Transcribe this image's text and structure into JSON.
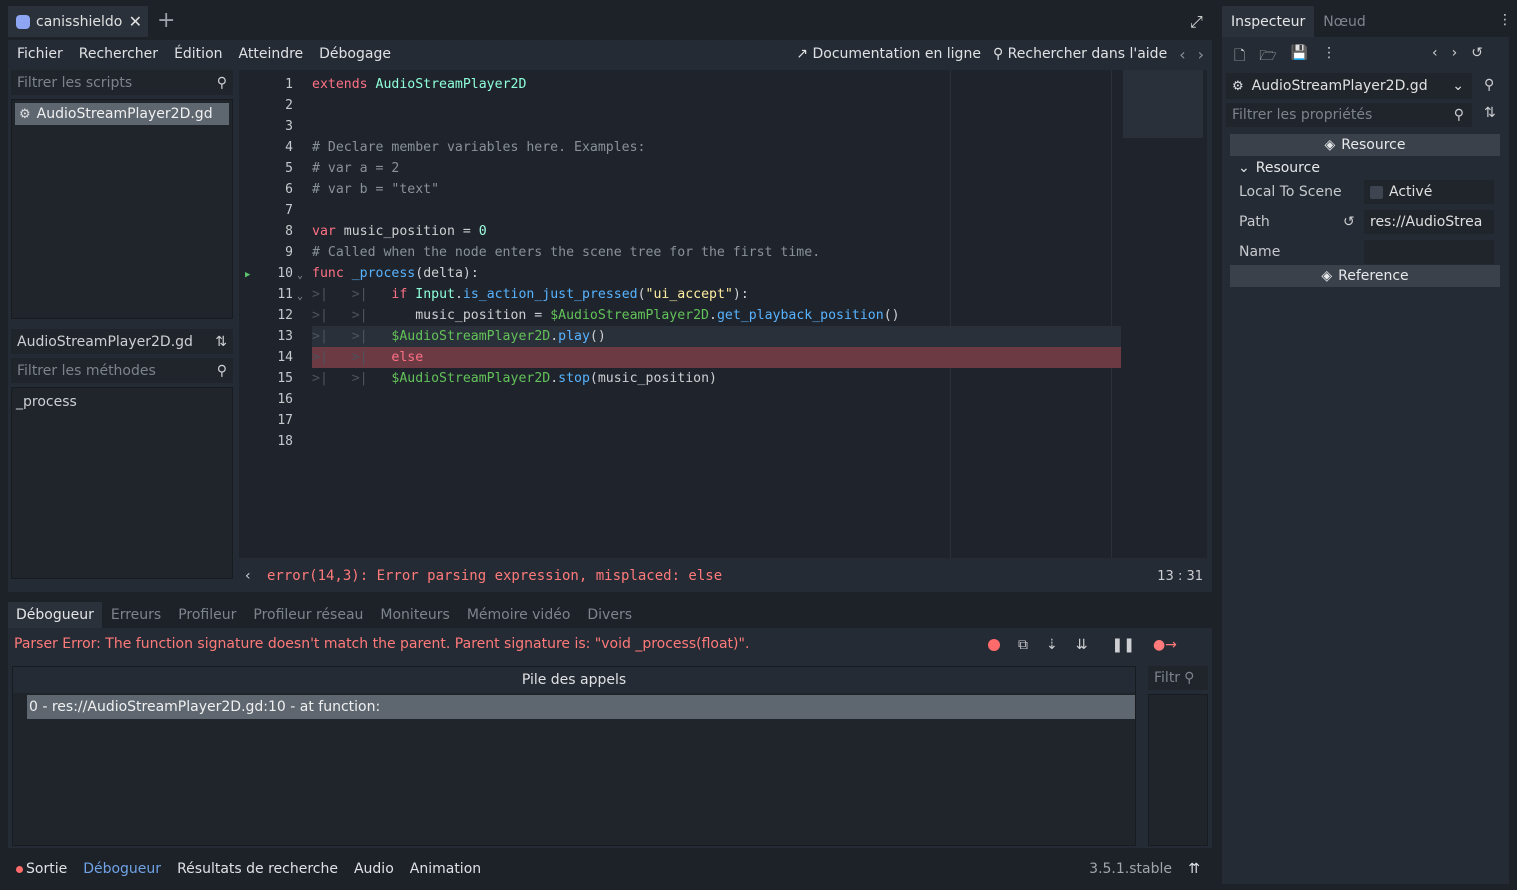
{
  "scene_tab": {
    "label": "canisshieldo"
  },
  "menus": [
    "Fichier",
    "Rechercher",
    "Édition",
    "Atteindre",
    "Débogage"
  ],
  "menu_right": {
    "docs": "Documentation en ligne",
    "help": "Rechercher dans l'aide"
  },
  "scripts": {
    "filter_placeholder": "Filtrer les scripts",
    "items": [
      "AudioStreamPlayer2D.gd"
    ]
  },
  "methods": {
    "current_script": "AudioStreamPlayer2D.gd",
    "filter_placeholder": "Filtrer les méthodes",
    "items": [
      "_process"
    ]
  },
  "editor": {
    "line_numbers": [
      "1",
      "2",
      "3",
      "4",
      "5",
      "6",
      "7",
      "8",
      "9",
      "10",
      "11",
      "12",
      "13",
      "14",
      "15",
      "16",
      "17",
      "18"
    ],
    "lines": {
      "l1_kw": "extends",
      "l1_type": "AudioStreamPlayer2D",
      "l4": "# Declare member variables here. Examples:",
      "l5": "# var a = 2",
      "l6": "# var b = \"text\"",
      "l8_kw": "var",
      "l8_name": "music_position = ",
      "l8_num": "0",
      "l9": "# Called when the node enters the scene tree for the first time.",
      "l10_kw": "func",
      "l10_fn": "_process",
      "l10_rest": "(delta):",
      "l11_kw": "if",
      "l11_type": "Input",
      "l11_dot": ".",
      "l11_fn": "is_action_just_pressed",
      "l11_open": "(",
      "l11_str": "\"ui_accept\"",
      "l11_close": "):",
      "l12_name": "music_position = ",
      "l12_node": "$AudioStreamPlayer2D",
      "l12_dot": ".",
      "l12_fn": "get_playback_position",
      "l12_close": "()",
      "l13_node": "$AudioStreamPlayer2D",
      "l13_dot": ".",
      "l13_fn": "play",
      "l13_close": "()",
      "l14_kw": "else",
      "l15_node": "$AudioStreamPlayer2D",
      "l15_dot": ".",
      "l15_fn": "stop",
      "l15_rest": "(music_position)"
    },
    "error_message": "error(14,3): Error parsing expression, misplaced: else",
    "cursor": "13 :   31"
  },
  "debugger": {
    "tabs": [
      "Débogueur",
      "Erreurs",
      "Profileur",
      "Profileur réseau",
      "Moniteurs",
      "Mémoire vidéo",
      "Divers"
    ],
    "parser_error": "Parser Error: The function signature doesn't match the parent. Parent signature is: \"void _process(float)\".",
    "callstack_header": "Pile des appels",
    "callstack_row": "0 - res://AudioStreamPlayer2D.gd:10 - at function:",
    "filter_placeholder": "Filtr"
  },
  "bottom_panel": {
    "items": [
      "Sortie",
      "Débogueur",
      "Résultats de recherche",
      "Audio",
      "Animation"
    ],
    "version": "3.5.1.stable"
  },
  "inspector": {
    "tabs": [
      "Inspecteur",
      "Nœud"
    ],
    "resource_name": "AudioStreamPlayer2D.gd",
    "filter_placeholder": "Filtrer les propriétés",
    "section_resource": "Resource",
    "subsection_resource": "Resource",
    "props": {
      "local_to_scene_label": "Local To Scene",
      "local_to_scene_value": "Activé",
      "path_label": "Path",
      "path_value": "res://AudioStrea",
      "name_label": "Name"
    },
    "section_reference": "Reference"
  }
}
